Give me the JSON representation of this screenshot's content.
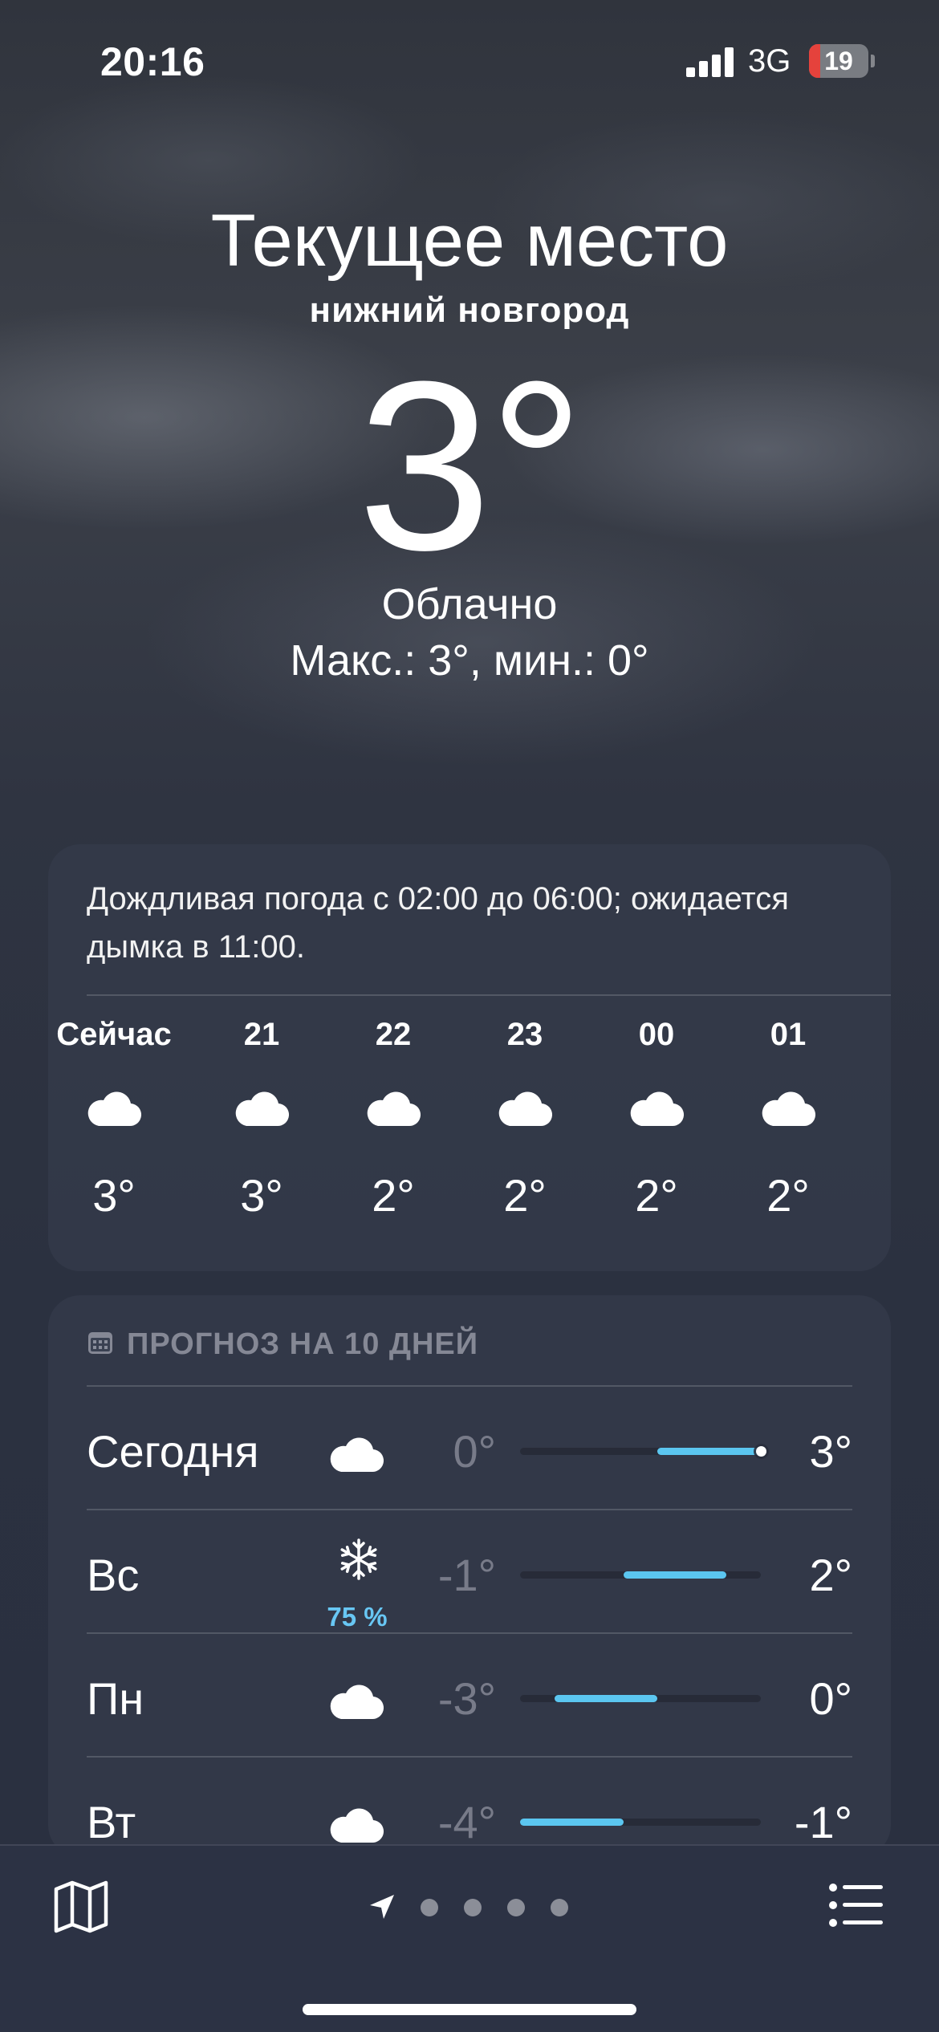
{
  "status_bar": {
    "time": "20:16",
    "network": "3G",
    "battery": "19",
    "battery_level": 0.19
  },
  "location": {
    "title": "Текущее место",
    "city": "нижний новгород"
  },
  "current": {
    "temp": "3°",
    "condition": "Облачно",
    "hi_lo": "Макс.: 3°, мин.: 0°"
  },
  "hourly": {
    "summary": "Дождливая погода с 02:00 до 06:00; ожидается дымка в 11:00.",
    "items": [
      {
        "hour": "Сейчас",
        "icon": "cloud-icon",
        "temp": "3°"
      },
      {
        "hour": "21",
        "icon": "cloud-icon",
        "temp": "3°"
      },
      {
        "hour": "22",
        "icon": "cloud-icon",
        "temp": "2°"
      },
      {
        "hour": "23",
        "icon": "cloud-icon",
        "temp": "2°"
      },
      {
        "hour": "00",
        "icon": "cloud-icon",
        "temp": "2°"
      },
      {
        "hour": "01",
        "icon": "cloud-icon",
        "temp": "2°"
      }
    ]
  },
  "forecast": {
    "header": "ПРОГНОЗ НА 10 ДНЕЙ",
    "header_icon": "calendar-icon",
    "range": [
      -4,
      3
    ],
    "current_temp_value": 3,
    "days": [
      {
        "day": "Сегодня",
        "icon": "cloud-icon",
        "precip": "",
        "low": "0°",
        "high": "3°",
        "low_value": 0,
        "high_value": 3,
        "is_today": true
      },
      {
        "day": "Вс",
        "icon": "snowflake-icon",
        "precip": "75 %",
        "low": "-1°",
        "high": "2°",
        "low_value": -1,
        "high_value": 2,
        "is_today": false
      },
      {
        "day": "Пн",
        "icon": "cloud-icon",
        "precip": "",
        "low": "-3°",
        "high": "0°",
        "low_value": -3,
        "high_value": 0,
        "is_today": false
      },
      {
        "day": "Вт",
        "icon": "cloud-icon",
        "precip": "",
        "low": "-4°",
        "high": "-1°",
        "low_value": -4,
        "high_value": -1,
        "is_today": false
      }
    ]
  },
  "bottom_bar": {
    "map_icon": "map-icon",
    "list_icon": "list-icon",
    "location_icon": "location-arrow-icon",
    "page_count": 4
  },
  "colors": {
    "accent_bar": "#5bc6f0",
    "precip_text": "#68c7f4",
    "battery_low": "#e5423c"
  }
}
